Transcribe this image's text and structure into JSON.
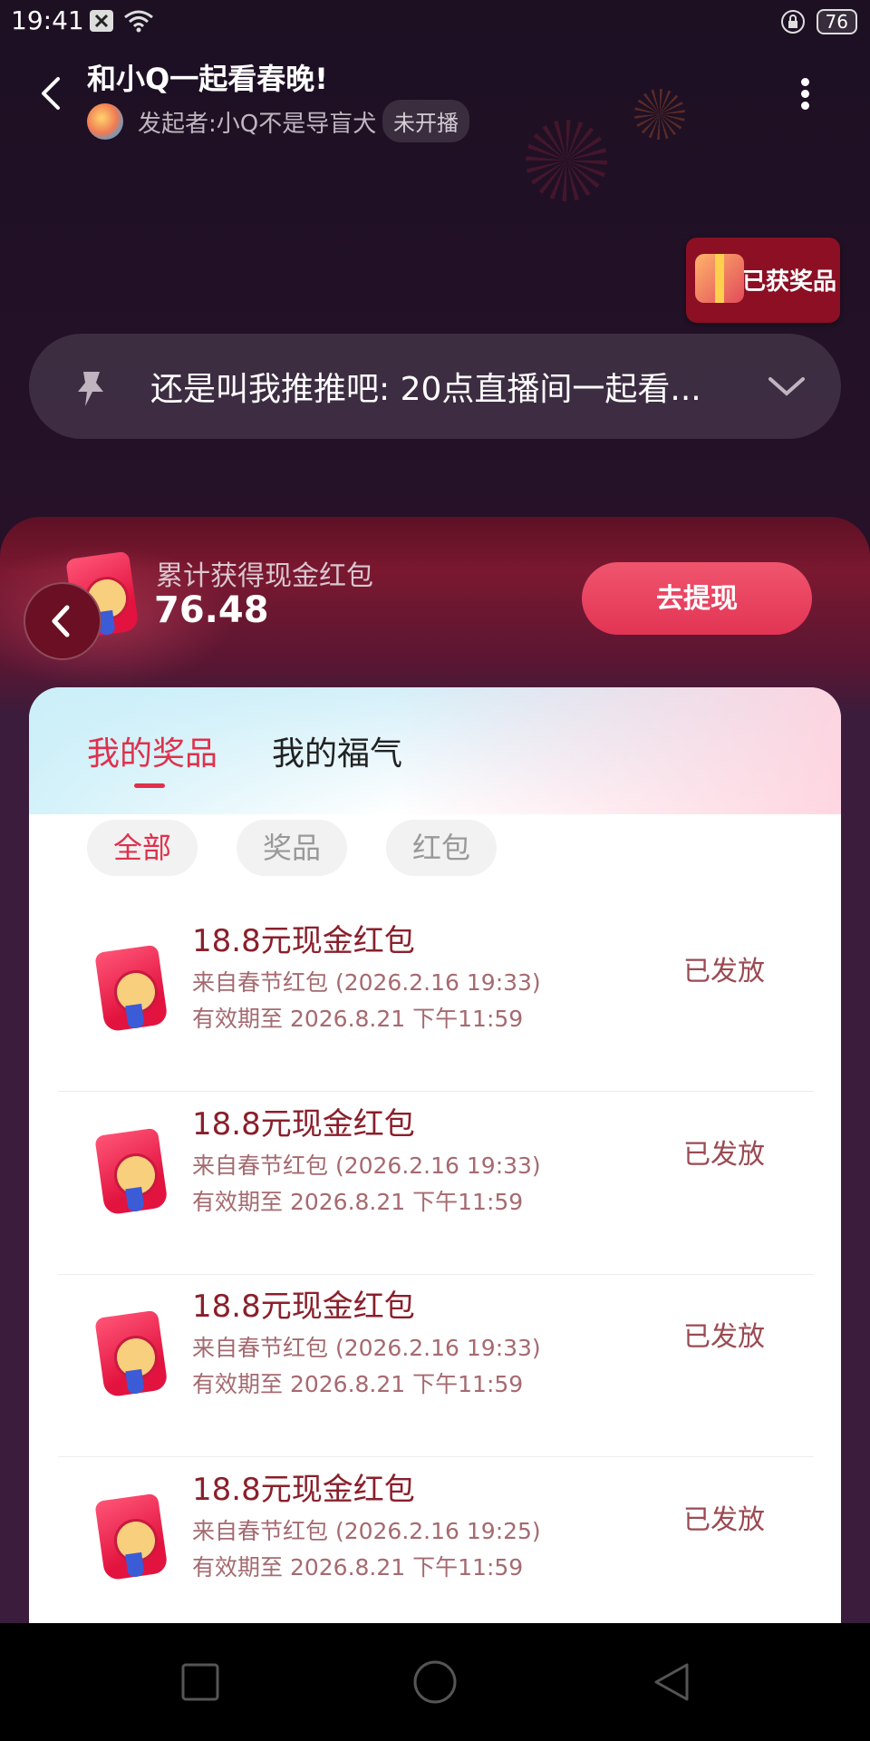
{
  "status_bar": {
    "time": "19:41",
    "battery": "76"
  },
  "header": {
    "title": "和小Q一起看春晚!",
    "organizer": "发起者:小Q不是导盲犬",
    "status_badge": "未开播"
  },
  "prize_badge": {
    "label": "已获奖品"
  },
  "pinned": {
    "text": "还是叫我推推吧: 20点直播间一起看..."
  },
  "summary": {
    "label": "累计获得现金红包",
    "value": "76.48",
    "withdraw": "去提现"
  },
  "tabs": [
    "我的奖品",
    "我的福气"
  ],
  "filters": [
    "全部",
    "奖品",
    "红包"
  ],
  "items": [
    {
      "title": "18.8元现金红包",
      "source": "来自春节红包 (2026.2.16 19:33)",
      "expiry": "有效期至 2026.8.21 下午11:59",
      "status": "已发放"
    },
    {
      "title": "18.8元现金红包",
      "source": "来自春节红包 (2026.2.16 19:33)",
      "expiry": "有效期至 2026.8.21 下午11:59",
      "status": "已发放"
    },
    {
      "title": "18.8元现金红包",
      "source": "来自春节红包 (2026.2.16 19:33)",
      "expiry": "有效期至 2026.8.21 下午11:59",
      "status": "已发放"
    },
    {
      "title": "18.8元现金红包",
      "source": "来自春节红包 (2026.2.16 19:25)",
      "expiry": "有效期至 2026.8.21 下午11:59",
      "status": "已发放"
    }
  ],
  "icons": {
    "back": "back-arrow-icon",
    "more": "more-vertical-icon",
    "pin": "pin-icon",
    "chevron": "chevron-down-icon",
    "red_packet": "red-packet-icon",
    "nav": [
      "square-icon",
      "circle-icon",
      "triangle-back-icon"
    ]
  },
  "colors": {
    "accent": "#e0304c",
    "primary_text": "#8a1f2b",
    "secondary_text": "#a56a70"
  }
}
